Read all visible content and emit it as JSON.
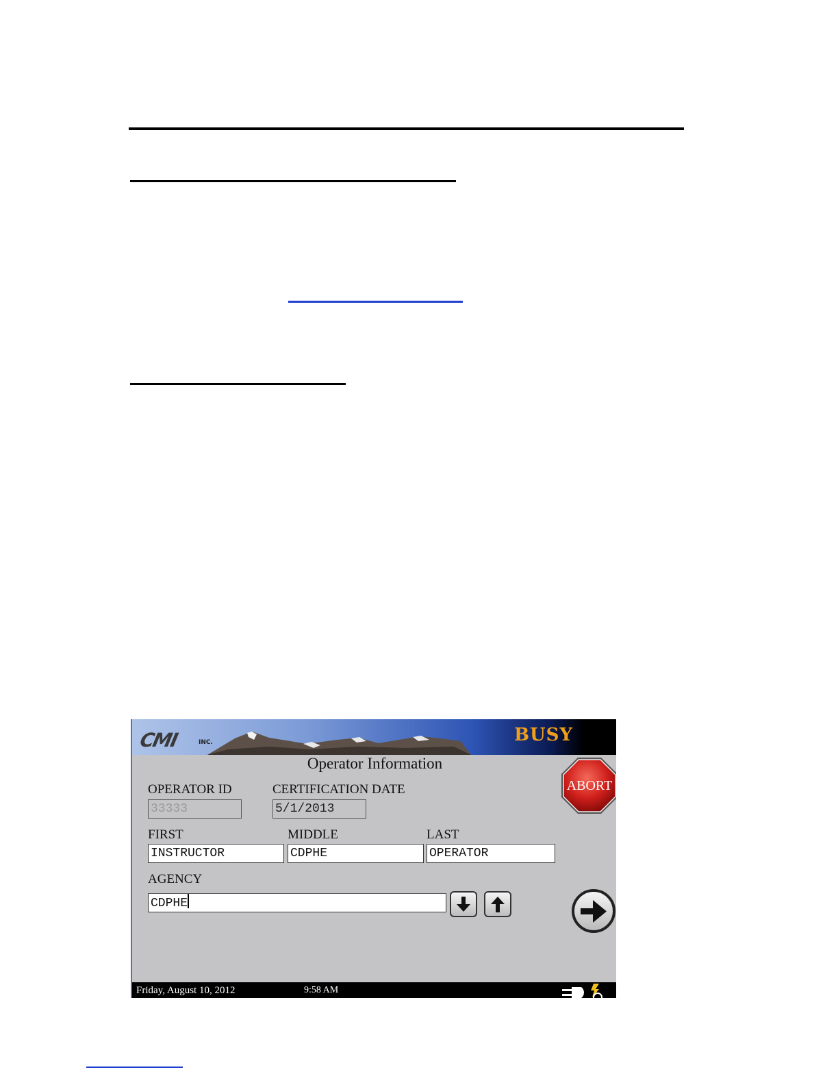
{
  "banner": {
    "logo_text": "CMI",
    "logo_suffix": "INC.",
    "status": "BUSY"
  },
  "form": {
    "title": "Operator Information",
    "operator_id": {
      "label": "OPERATOR ID",
      "value": "33333"
    },
    "certification_date": {
      "label": "CERTIFICATION DATE",
      "value": "5/1/2013"
    },
    "first": {
      "label": "FIRST",
      "value": "INSTRUCTOR"
    },
    "middle": {
      "label": "MIDDLE",
      "value": "CDPHE"
    },
    "last": {
      "label": "LAST",
      "value": "OPERATOR"
    },
    "agency": {
      "label": "AGENCY",
      "value": "CDPHE"
    }
  },
  "buttons": {
    "abort_label": "ABORT",
    "down_icon": "arrow-down-icon",
    "up_icon": "arrow-up-icon",
    "next_icon": "arrow-right-circle-icon"
  },
  "statusbar": {
    "date": "Friday, August 10, 2012",
    "time": "9:58 AM"
  },
  "colors": {
    "screen_bg": "#c4c4c7",
    "busy": "#f0a018",
    "abort_red": "#d0201c"
  }
}
